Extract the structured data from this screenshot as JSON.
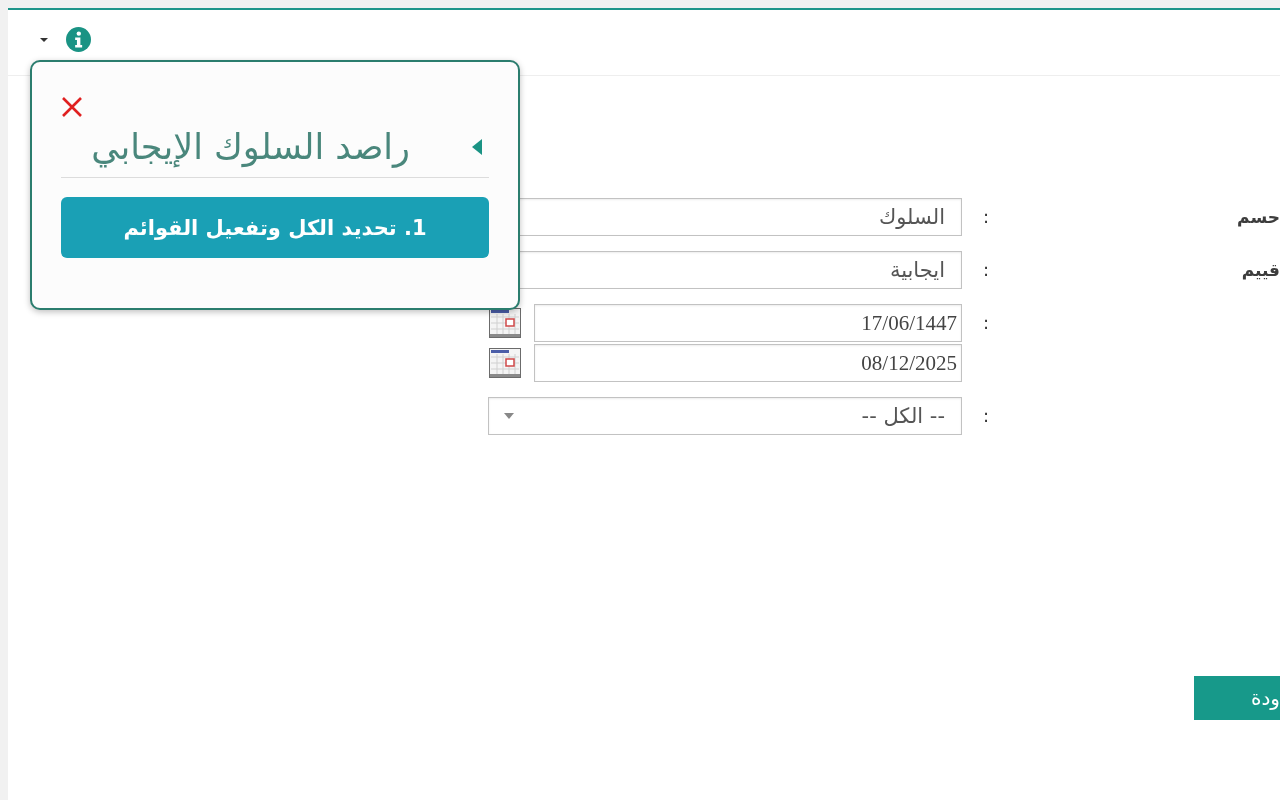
{
  "popover": {
    "title": "راصد السلوك الإيجابي",
    "action": "1. تحديد الكل وتفعيل القوائم"
  },
  "form": {
    "rows": [
      {
        "kind": "text",
        "label": "حسم",
        "separator": ":",
        "value": "السلوك"
      },
      {
        "kind": "text",
        "label": "قييم",
        "separator": ":",
        "value": "ايجابية"
      },
      {
        "kind": "dates",
        "separator": ":",
        "values": [
          "17/06/1447",
          "08/12/2025"
        ]
      },
      {
        "kind": "select",
        "separator": ":",
        "value": "-- الكل --"
      }
    ]
  },
  "buttons": [
    "ودة"
  ]
}
